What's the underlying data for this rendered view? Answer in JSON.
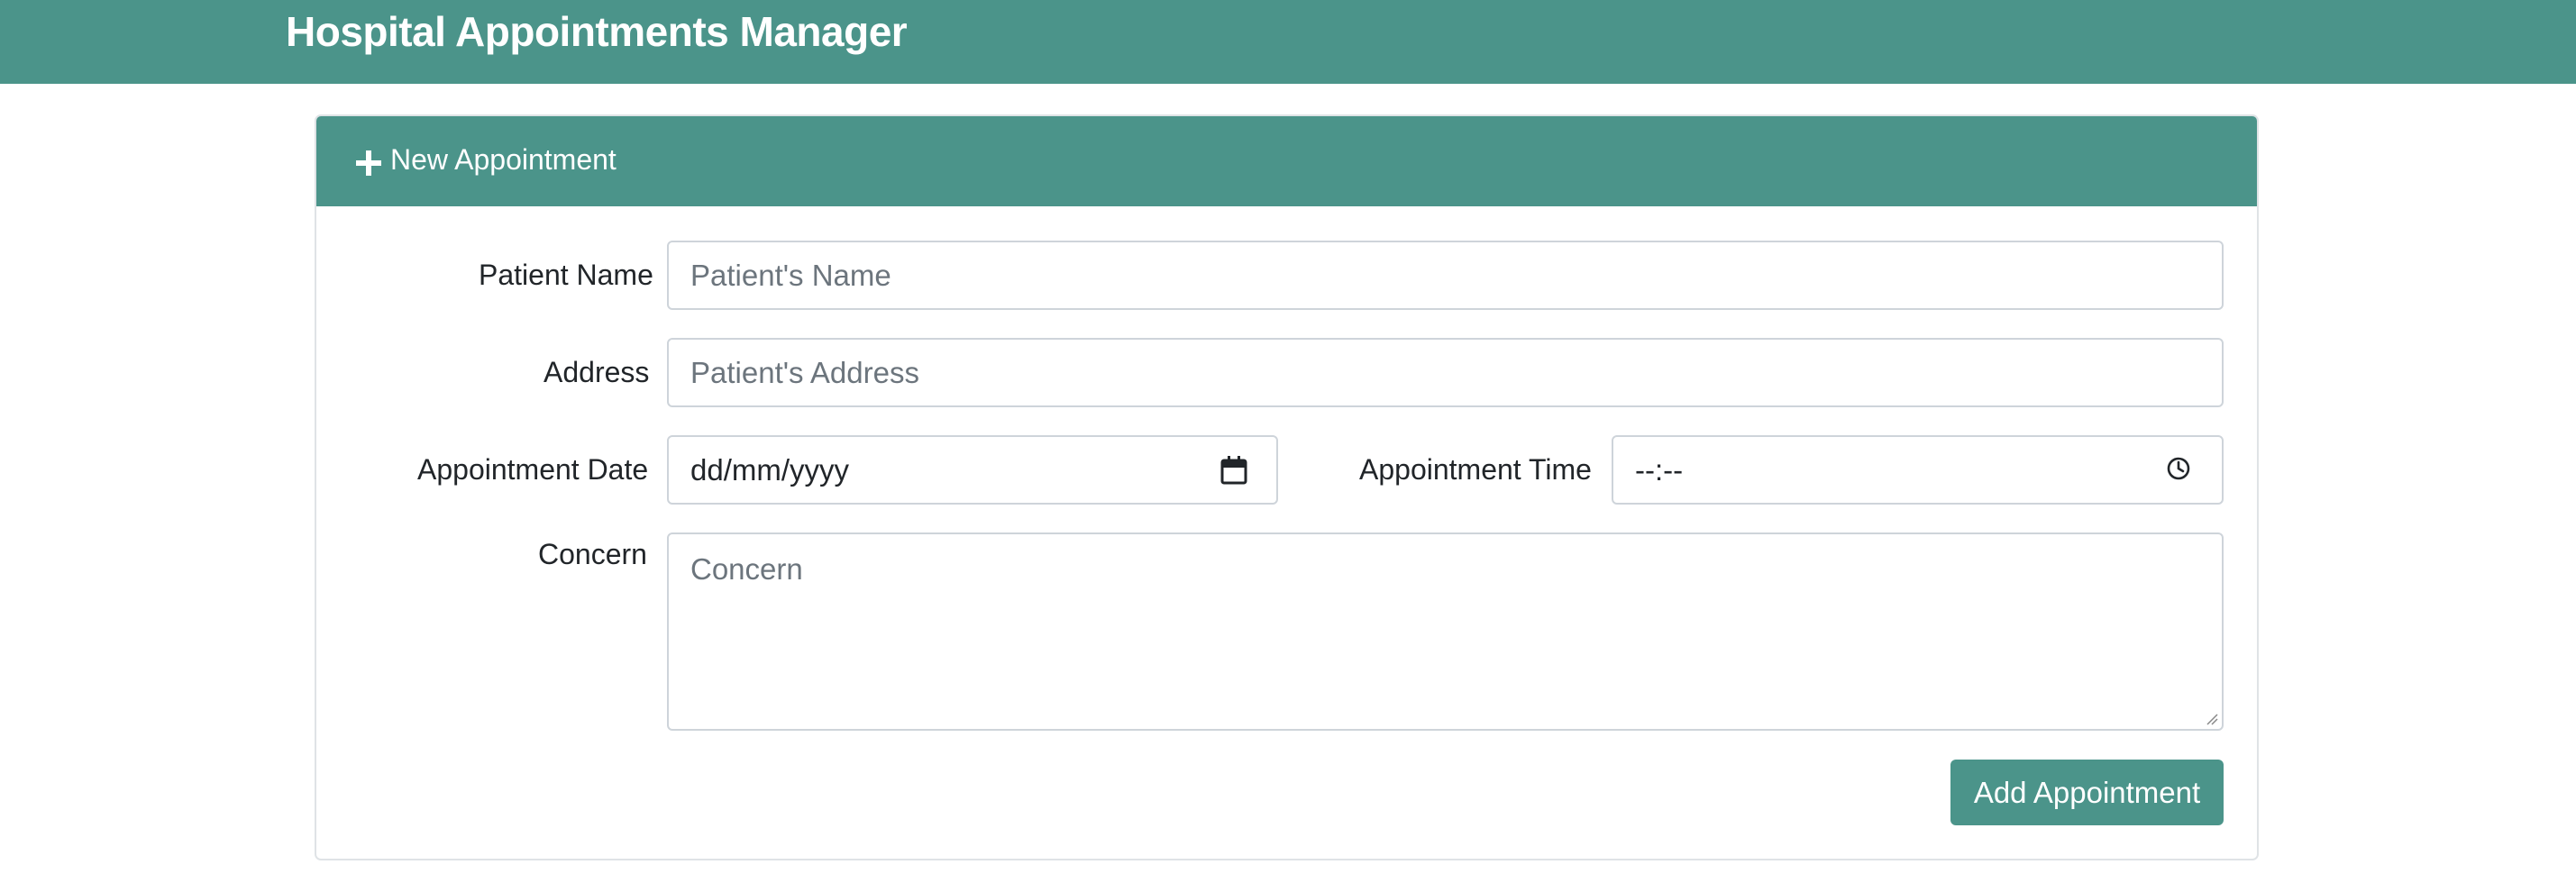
{
  "app": {
    "title": "Hospital Appointments Manager"
  },
  "card": {
    "header_title": "New Appointment",
    "header_icon": "plus-icon"
  },
  "form": {
    "patient_name": {
      "label": "Patient Name",
      "placeholder": "Patient's Name",
      "value": ""
    },
    "address": {
      "label": "Address",
      "placeholder": "Patient's Address",
      "value": ""
    },
    "appointment_date": {
      "label": "Appointment Date",
      "placeholder": "dd/mm/yyyy",
      "icon": "calendar-icon"
    },
    "appointment_time": {
      "label": "Appointment Time",
      "placeholder": "--:--",
      "icon": "clock-icon"
    },
    "concern": {
      "label": "Concern",
      "placeholder": "Concern",
      "value": ""
    },
    "submit_label": "Add Appointment"
  },
  "colors": {
    "brand": "#4b948a",
    "border": "#ced4da",
    "placeholder": "#6c757d"
  }
}
